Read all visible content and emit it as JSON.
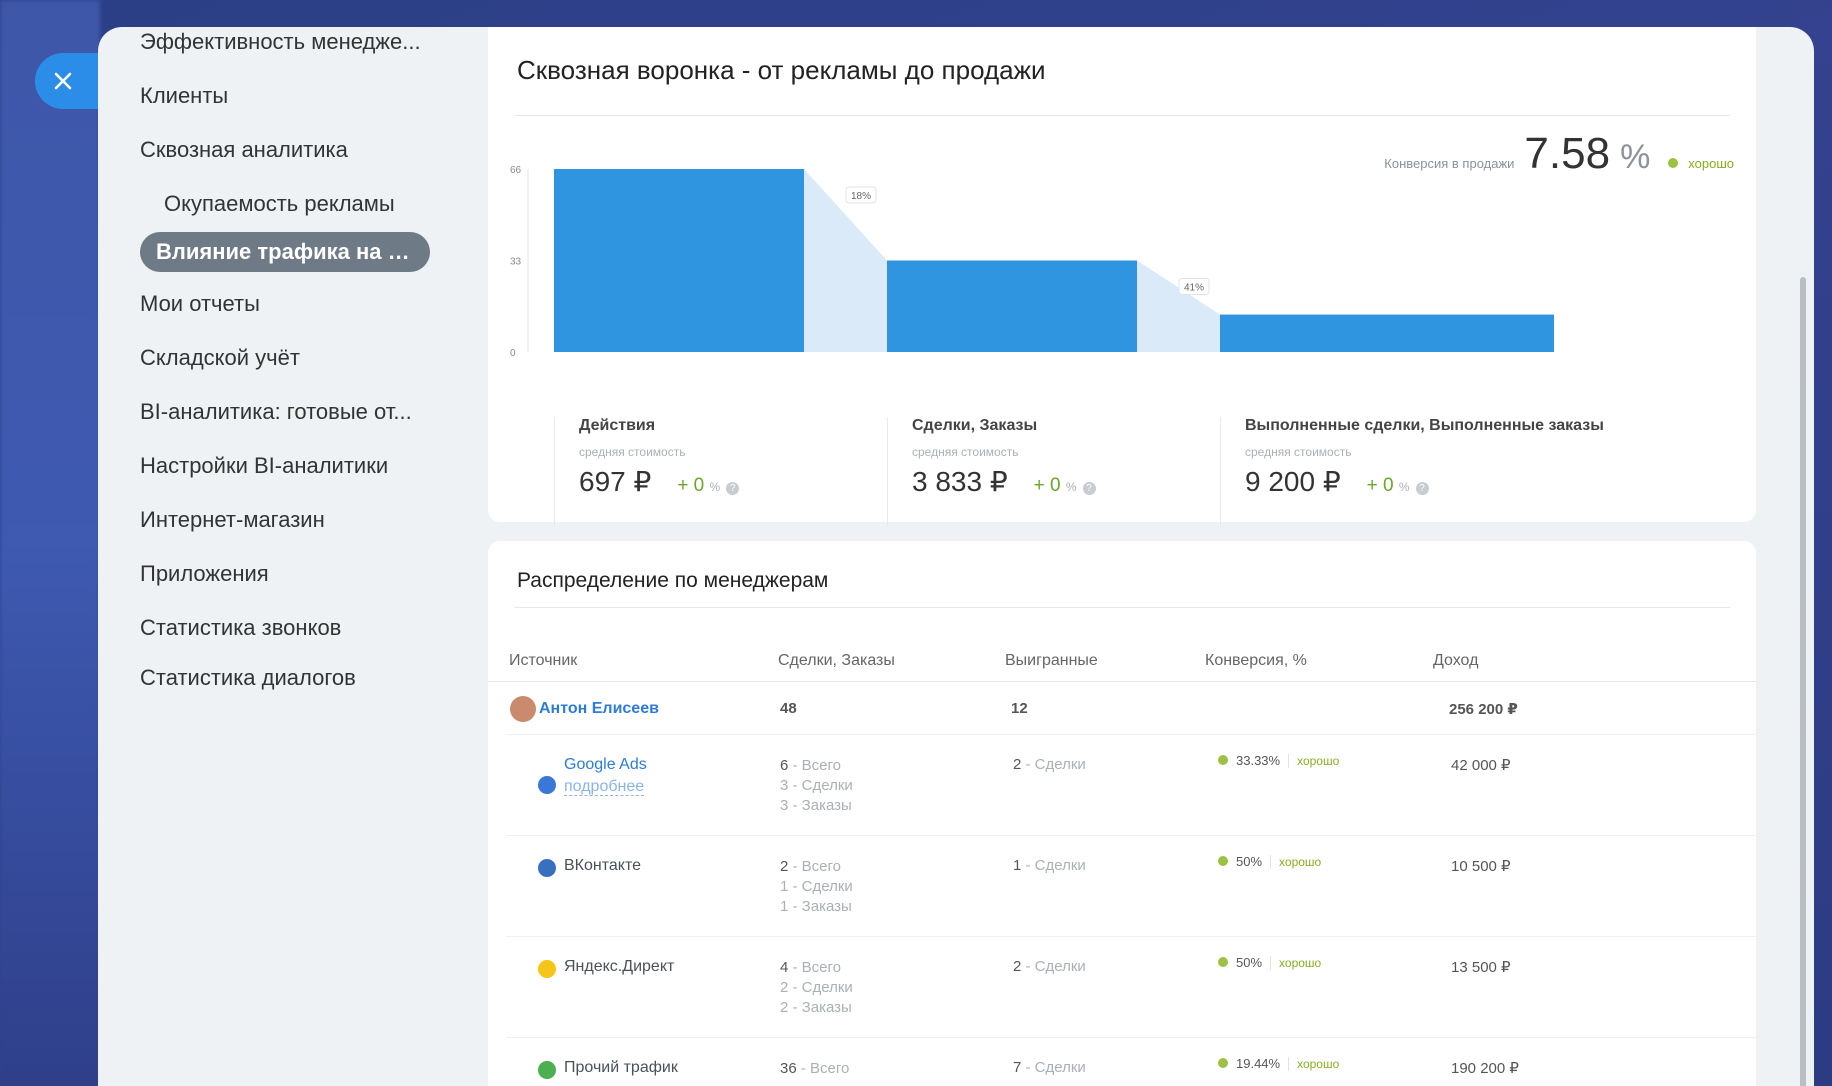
{
  "sidebar": {
    "items": [
      {
        "label": "Эффективность менедже..."
      },
      {
        "label": "Клиенты"
      },
      {
        "label": "Сквозная аналитика"
      },
      {
        "label": "Окупаемость рекламы"
      },
      {
        "label": "Влияние трафика на п..."
      },
      {
        "label": "Мои отчеты"
      },
      {
        "label": "Складской учёт"
      },
      {
        "label": "BI-аналитика: готовые от..."
      },
      {
        "label": "Настройки BI-аналитики"
      },
      {
        "label": "Интернет-магазин"
      },
      {
        "label": "Приложения"
      },
      {
        "label": "Статистика звонков"
      },
      {
        "label": "Статистика диалогов"
      }
    ]
  },
  "funnel": {
    "title": "Сквозная воронка - от рекламы до продажи",
    "conversion_label": "Конверсия в продажи",
    "conversion_value": "7.58",
    "conversion_unit": "%",
    "conversion_status": "хорошо",
    "stages": [
      {
        "name": "Действия",
        "sub": "средняя стоимость",
        "value": "697 ₽",
        "delta": "+ 0",
        "delta_unit": "%"
      },
      {
        "name": "Сделки, Заказы",
        "sub": "средняя стоимость",
        "value": "3 833 ₽",
        "delta": "+ 0",
        "delta_unit": "%"
      },
      {
        "name": "Выполненные сделки, Выполненные заказы",
        "sub": "средняя стоимость",
        "value": "9 200 ₽",
        "delta": "+ 0",
        "delta_unit": "%"
      }
    ]
  },
  "chart_data": {
    "type": "bar",
    "categories": [
      "Действия",
      "Сделки, Заказы",
      "Выполненные сделки, Выполненные заказы"
    ],
    "values": [
      66,
      33,
      13.5
    ],
    "ylim": [
      0,
      66
    ],
    "yticks": [
      "0",
      "33",
      "66"
    ],
    "transitions": [
      "18%",
      "41%"
    ],
    "colors": {
      "bar": "#2f95e0",
      "transition": "#dbeaf8"
    }
  },
  "managers": {
    "title": "Распределение по менеджерам",
    "columns": [
      "Источник",
      "Сделки, Заказы",
      "Выигранные",
      "Конверсия, %",
      "Доход"
    ],
    "manager": {
      "name": "Антон Елисеев",
      "deals": "48",
      "won": "12",
      "income": "256 200 ₽"
    },
    "sources": [
      {
        "name": "Google Ads",
        "more": "подробнее",
        "icon": "google-ads-icon",
        "icon_color": "#3a78d8",
        "deals": [
          {
            "n": "6",
            "t": "- Всего"
          },
          {
            "n": "3",
            "t": "- Сделки"
          },
          {
            "n": "3",
            "t": "- Заказы"
          }
        ],
        "won": "2",
        "won_t": "- Сделки",
        "conv": "33.33%",
        "status": "хорошо",
        "income": "42 000 ₽"
      },
      {
        "name": "ВКонтакте",
        "icon": "vk-icon",
        "icon_color": "#3a6fc0",
        "deals": [
          {
            "n": "2",
            "t": "- Всего"
          },
          {
            "n": "1",
            "t": "- Сделки"
          },
          {
            "n": "1",
            "t": "- Заказы"
          }
        ],
        "won": "1",
        "won_t": "- Сделки",
        "conv": "50%",
        "status": "хорошо",
        "income": "10 500 ₽"
      },
      {
        "name": "Яндекс.Директ",
        "icon": "yandex-direct-icon",
        "icon_color": "#f5c518",
        "deals": [
          {
            "n": "4",
            "t": "- Всего"
          },
          {
            "n": "2",
            "t": "- Сделки"
          },
          {
            "n": "2",
            "t": "- Заказы"
          }
        ],
        "won": "2",
        "won_t": "- Сделки",
        "conv": "50%",
        "status": "хорошо",
        "income": "13 500 ₽"
      },
      {
        "name": "Прочий трафик",
        "icon": "other-traffic-icon",
        "icon_color": "#4caf50",
        "deals": [
          {
            "n": "36",
            "t": "- Всего"
          }
        ],
        "won": "7",
        "won_t": "- Сделки",
        "conv": "19.44%",
        "status": "хорошо",
        "income": "190 200 ₽"
      }
    ]
  }
}
